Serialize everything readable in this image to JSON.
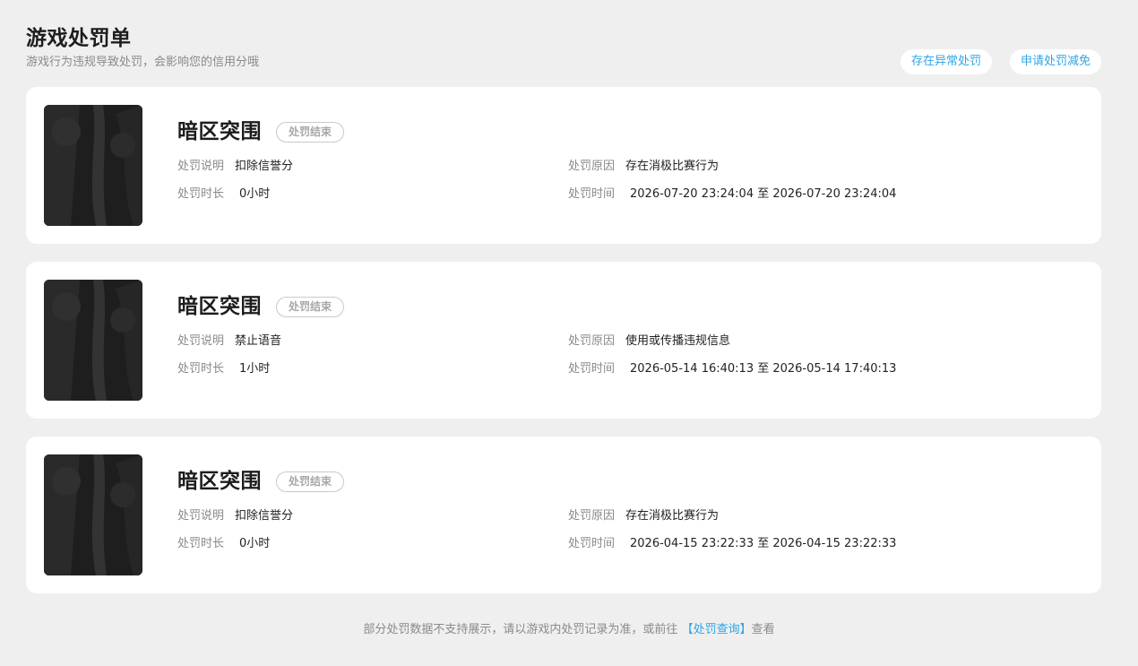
{
  "header": {
    "title": "游戏处罚单",
    "subtitle": "游戏行为违规导致处罚，会影响您的信用分哦"
  },
  "actions": {
    "abnormal_label": "存在异常处罚",
    "reduce_label": "申请处罚减免"
  },
  "labels": {
    "desc": "处罚说明",
    "duration": "处罚时长",
    "reason": "处罚原因",
    "time": "处罚时间"
  },
  "records": [
    {
      "game": "暗区突围",
      "status": "处罚结束",
      "desc": "扣除信誉分",
      "duration": "0小时",
      "reason": "存在消极比赛行为",
      "time": "2026-07-20 23:24:04 至 2026-07-20 23:24:04"
    },
    {
      "game": "暗区突围",
      "status": "处罚结束",
      "desc": "禁止语音",
      "duration": "1小时",
      "reason": "使用或传播违规信息",
      "time": "2026-05-14 16:40:13 至 2026-05-14 17:40:13"
    },
    {
      "game": "暗区突围",
      "status": "处罚结束",
      "desc": "扣除信誉分",
      "duration": "0小时",
      "reason": "存在消极比赛行为",
      "time": "2026-04-15 23:22:33 至 2026-04-15 23:22:33"
    }
  ],
  "footer": {
    "prefix": "部分处罚数据不支持展示，请以游戏内处罚记录为准，或前往",
    "link": "【处罚查询】",
    "suffix": "查看"
  },
  "colors": {
    "accent": "#2fa5e6",
    "background": "#efefef",
    "card": "#ffffff"
  }
}
